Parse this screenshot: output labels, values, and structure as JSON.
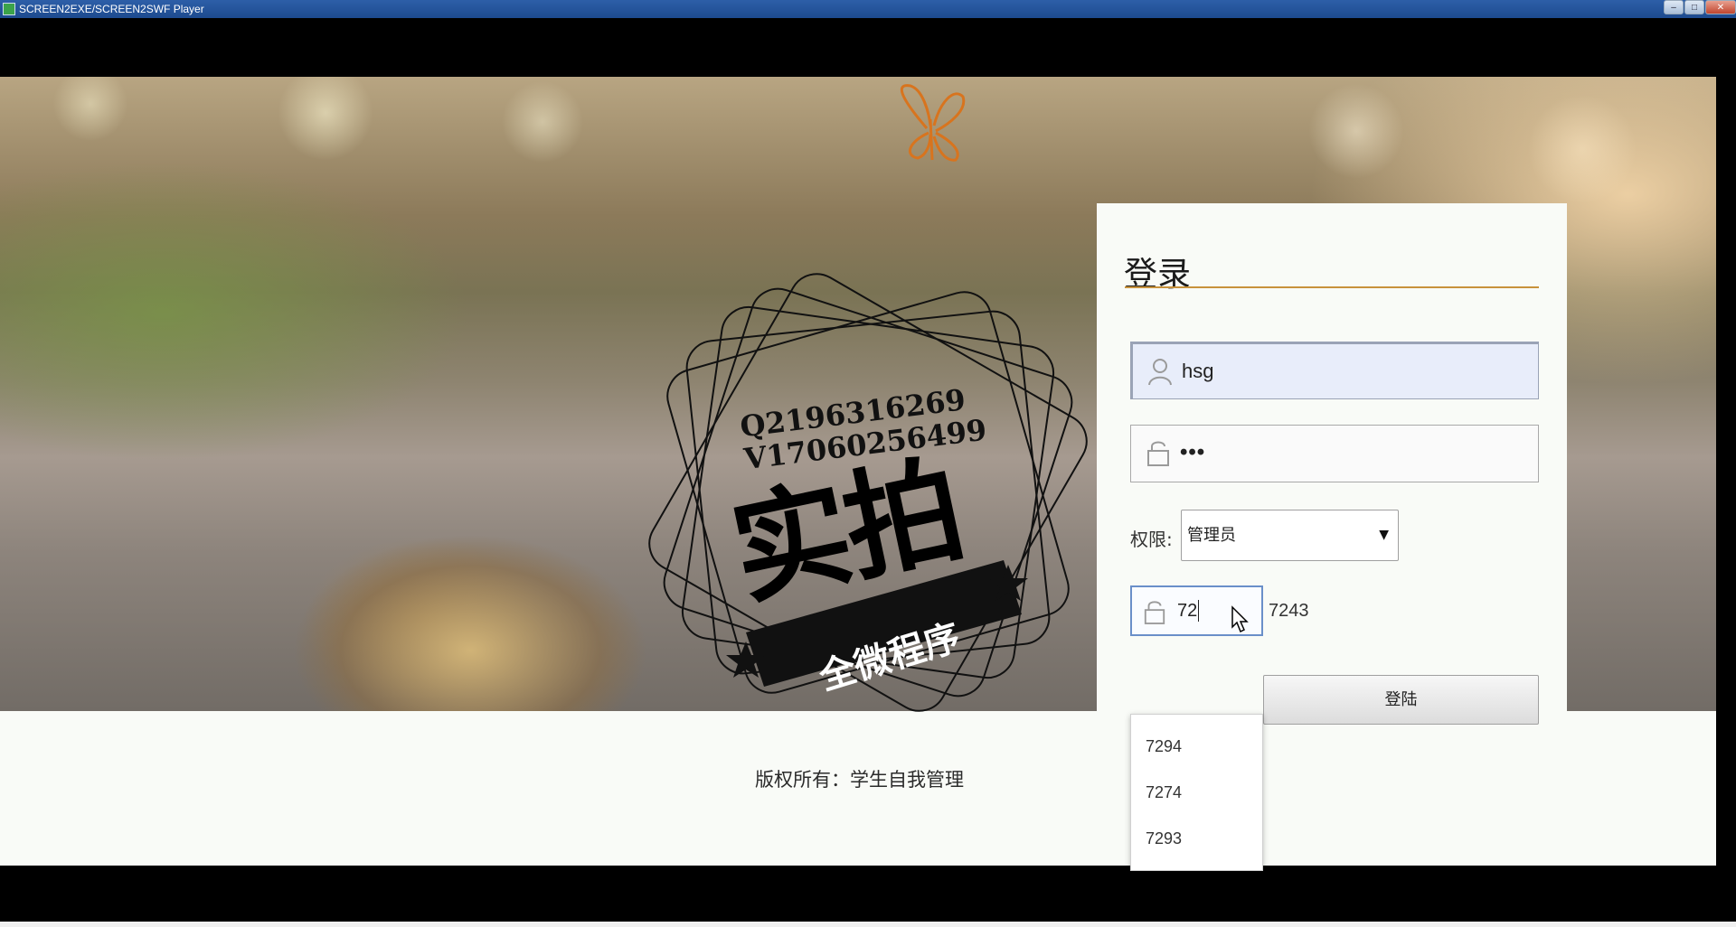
{
  "window": {
    "title": "SCREEN2EXE/SCREEN2SWF Player",
    "buttons": {
      "minimize": "–",
      "maximize": "□",
      "close": "✕"
    }
  },
  "watermark": {
    "line1": "Q2196316269",
    "line2": "V17060256499",
    "big_text": "实拍",
    "banner_text": "全微程序"
  },
  "login": {
    "title": "登录",
    "username_value": "hsg",
    "password_value": "•••",
    "role_label": "权限:",
    "role_value": "管理员",
    "captcha_value": "72",
    "captcha_code": "7243",
    "submit_label": "登陆",
    "suggestions": [
      "7294",
      "7274",
      "7293"
    ]
  },
  "footer": {
    "copyright": "版权所有：学生自我管理"
  },
  "colors": {
    "accent_rule": "#c8923c",
    "captcha_focus": "#6a8fc9",
    "titlebar": "#2d5fa8"
  }
}
